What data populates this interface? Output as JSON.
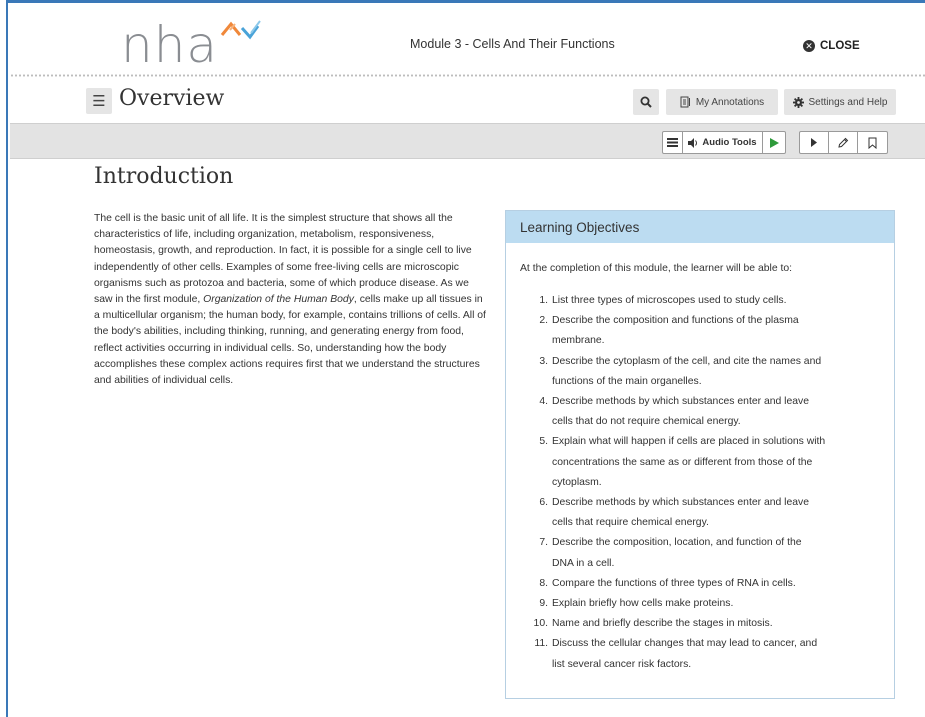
{
  "header": {
    "logo_text": "nha",
    "module_title": "Module 3 - Cells And Their Functions",
    "close_label": "CLOSE"
  },
  "titlebar": {
    "page_heading": "Overview",
    "annotations_label": "My Annotations",
    "settings_label": "Settings and Help"
  },
  "toolbar": {
    "audio_tools_label": "Audio Tools"
  },
  "content": {
    "intro_heading": "Introduction",
    "intro_part1": "The cell is the basic unit of all life. It is the simplest structure that shows all the characteristics of life, including organization, metabolism, responsiveness, homeostasis, growth, and reproduction. In fact, it is possible for a single cell to live independently of other cells. Examples of some free-living cells are microscopic organisms such as protozoa and bacteria, some of which produce disease. As we saw in the first module, ",
    "intro_italic": "Organization of the Human Body",
    "intro_part2": ", cells make up all tissues in a multicellular organism; the human body, for example, contains trillions of cells. All of the body's abilities, including thinking, running, and generating energy from food, reflect activities occurring in individual cells. So, understanding how the body accomplishes these complex actions requires first that we understand the structures and abilities of individual cells."
  },
  "objectives": {
    "title": "Learning Objectives",
    "intro": "At the completion of this module, the learner will be able to:",
    "items": [
      {
        "num": "1.",
        "lines": [
          "List three types of microscopes used to study cells."
        ]
      },
      {
        "num": "2.",
        "lines": [
          "Describe the composition and functions of the plasma",
          "membrane."
        ]
      },
      {
        "num": "3.",
        "lines": [
          "Describe the cytoplasm of the cell, and cite the names and",
          "functions of the main organelles."
        ]
      },
      {
        "num": "4.",
        "lines": [
          "Describe methods by which substances enter and leave",
          "cells that do not require chemical energy."
        ]
      },
      {
        "num": "5.",
        "lines": [
          "Explain what will happen if cells are placed in solutions with",
          "concentrations the same as or different from those of the",
          "cytoplasm."
        ]
      },
      {
        "num": "6.",
        "lines": [
          "Describe methods by which substances enter and leave",
          "cells that require chemical energy."
        ]
      },
      {
        "num": "7.",
        "lines": [
          "Describe the composition, location, and function of the",
          "DNA in a cell."
        ]
      },
      {
        "num": "8.",
        "lines": [
          "Compare the functions of three types of RNA in cells."
        ]
      },
      {
        "num": "9.",
        "lines": [
          "Explain briefly how cells make proteins."
        ]
      },
      {
        "num": "10.",
        "lines": [
          "Name and briefly describe the stages in mitosis."
        ]
      },
      {
        "num": "11.",
        "lines": [
          "Discuss the cellular changes that may lead to cancer, and",
          "list several cancer risk factors."
        ]
      }
    ]
  },
  "icons": {
    "close": "close-circle-icon",
    "menu": "hamburger-icon",
    "search": "search-icon",
    "annotations": "annotations-icon",
    "settings": "gear-icon",
    "speaker": "speaker-icon",
    "play": "play-icon",
    "pointer": "pointer-icon",
    "highlight": "pencil-icon",
    "bookmark": "bookmark-icon"
  },
  "colors": {
    "frame_blue": "#3a78b8",
    "logo_orange": "#f0883a",
    "logo_blue": "#4aa3d8",
    "objectives_header": "#bcdcf1",
    "play_green": "#2e9a3a"
  }
}
